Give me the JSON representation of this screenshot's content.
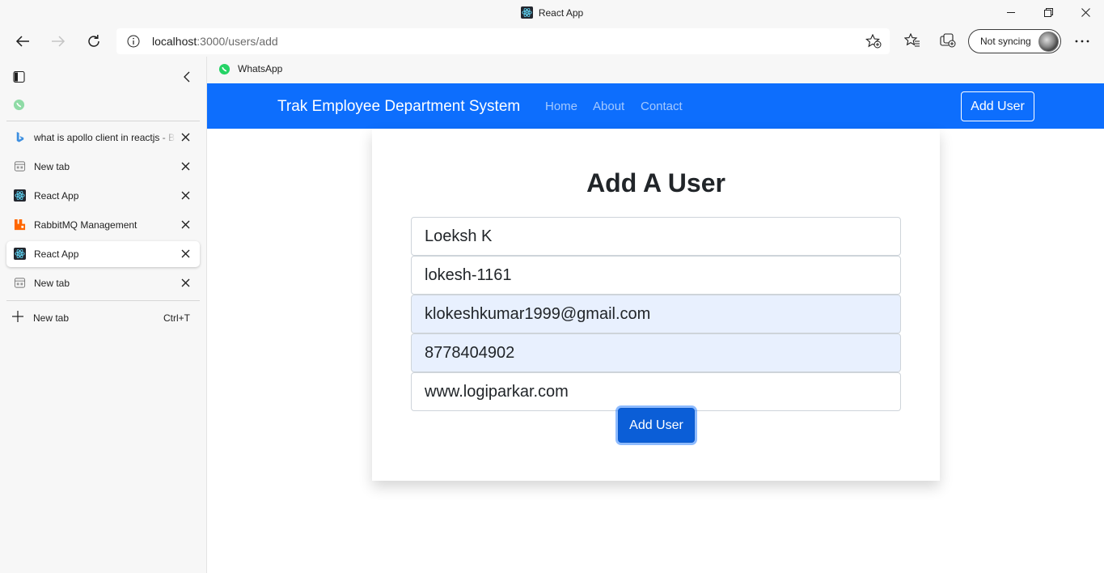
{
  "window": {
    "title": "React App"
  },
  "toolbar": {
    "url_host": "localhost",
    "url_rest": ":3000/users/add",
    "sync_label": "Not syncing"
  },
  "favorites": {
    "items": [
      {
        "label": "WhatsApp",
        "icon": "whatsapp-icon"
      }
    ]
  },
  "sidebar": {
    "tabs": [
      {
        "label": "what is apollo client in reactjs - B",
        "icon": "bing-icon"
      },
      {
        "label": "New tab",
        "icon": "new-tab-icon"
      },
      {
        "label": "React App",
        "icon": "react-icon"
      },
      {
        "label": "RabbitMQ Management",
        "icon": "rabbitmq-icon"
      },
      {
        "label": "React App",
        "icon": "react-icon",
        "active": true
      },
      {
        "label": "New tab",
        "icon": "new-tab-icon"
      }
    ],
    "new_tab_label": "New tab",
    "new_tab_shortcut": "Ctrl+T"
  },
  "app": {
    "brand": "Trak Employee Department System",
    "nav_links": [
      "Home",
      "About",
      "Contact"
    ],
    "nav_button": "Add User",
    "colors": {
      "primary": "#0d6efd",
      "button": "#0b5ed7",
      "autofill": "#e8f0fe"
    }
  },
  "form": {
    "heading": "Add A User",
    "fields": [
      {
        "value": "Loeksh K",
        "autofilled": false
      },
      {
        "value": "lokesh-1161",
        "autofilled": false
      },
      {
        "value": "klokeshkumar1999@gmail.com",
        "autofilled": true
      },
      {
        "value": "8778404902",
        "autofilled": true
      },
      {
        "value": "www.logiparkar.com",
        "autofilled": false
      }
    ],
    "submit_label": "Add User"
  }
}
